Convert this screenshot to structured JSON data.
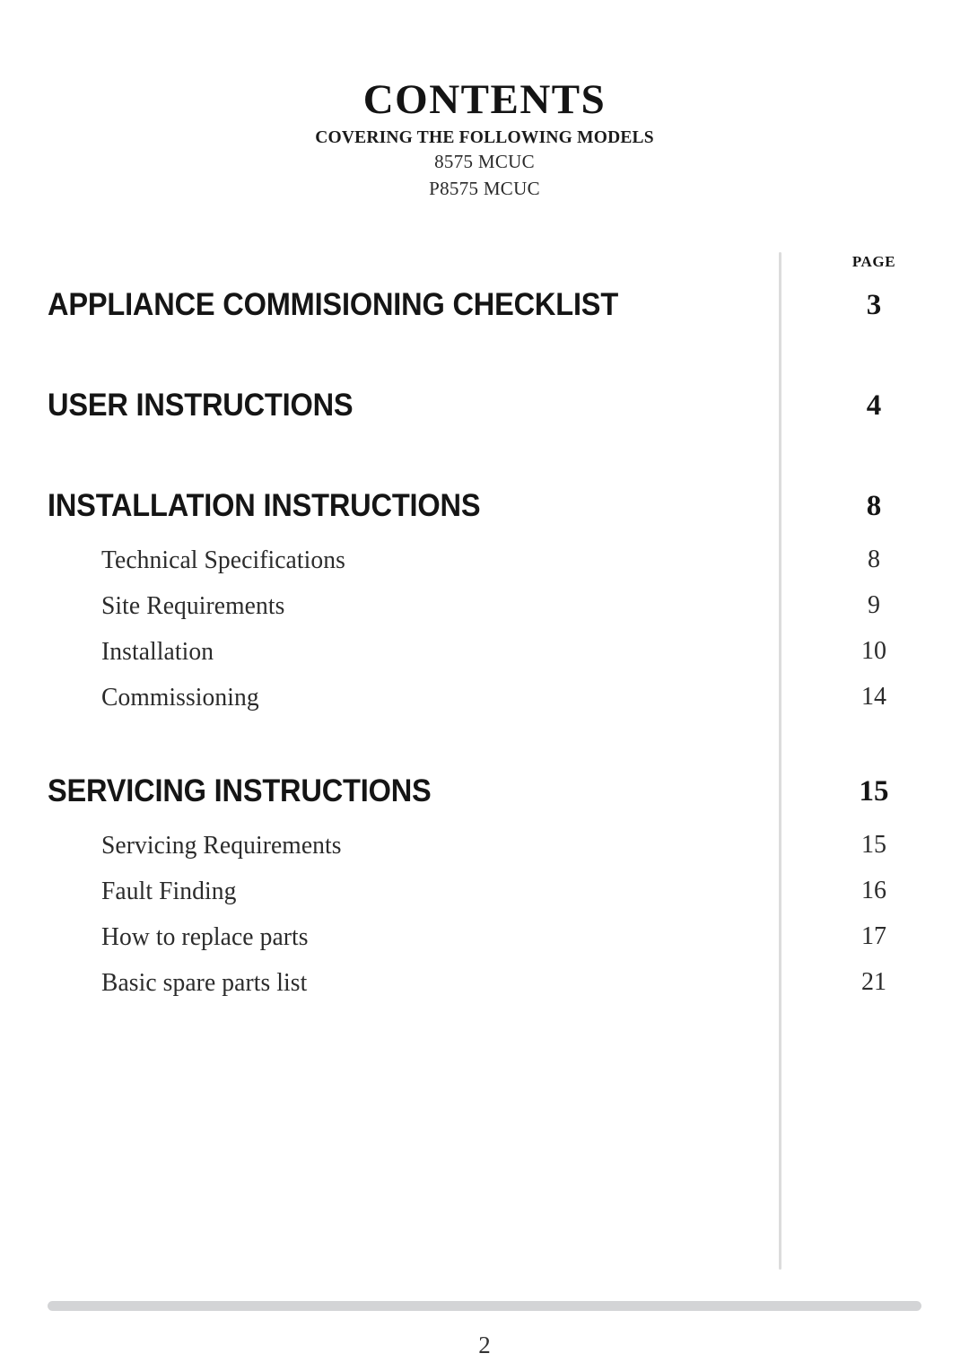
{
  "document": {
    "title": "CONTENTS",
    "models_label": "COVERING THE FOLLOWING MODELS",
    "models": [
      "8575 MCUC",
      "P8575 MCUC"
    ]
  },
  "page_column": {
    "header": "PAGE"
  },
  "toc": {
    "entries": [
      {
        "label": "APPLIANCE COMMISIONING CHECKLIST",
        "page": "3",
        "level": "major",
        "children": []
      },
      {
        "label": "USER INSTRUCTIONS",
        "page": "4",
        "level": "major",
        "children": []
      },
      {
        "label": "INSTALLATION INSTRUCTIONS",
        "page": "8",
        "level": "major",
        "children": [
          {
            "label": "Technical Specifications",
            "page": "8"
          },
          {
            "label": "Site Requirements",
            "page": "9"
          },
          {
            "label": "Installation",
            "page": "10"
          },
          {
            "label": "Commissioning",
            "page": "14"
          }
        ]
      },
      {
        "label": "SERVICING INSTRUCTIONS",
        "page": "15",
        "level": "major",
        "children": [
          {
            "label": "Servicing Requirements",
            "page": "15"
          },
          {
            "label": "Fault Finding",
            "page": "16"
          },
          {
            "label": "How to replace parts",
            "page": "17"
          },
          {
            "label": "Basic spare parts list",
            "page": "21"
          }
        ]
      }
    ]
  },
  "footer": {
    "page_number": "2"
  },
  "colors": {
    "text": "#1b1b1b",
    "divider": "#dcdcdc",
    "footer_rule": "#d3d4d6",
    "background": "#ffffff"
  }
}
